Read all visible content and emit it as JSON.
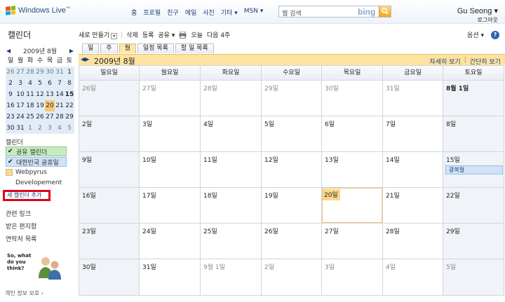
{
  "header": {
    "logo": "Windows Live",
    "logo_tm": "™",
    "nav": [
      "홈",
      "프로필",
      "친구",
      "메일",
      "사진",
      "기타 ▾",
      "MSN ▾"
    ],
    "search_value": "웹 검색",
    "search_brand": "bing",
    "user_name": "Gu Seong ▾",
    "user_sub": "로그아웃"
  },
  "sidebar": {
    "title": "캘린더",
    "mini_calendar": {
      "prev": "◀",
      "next": "▶",
      "month": "2009년 8월",
      "dow": [
        "일",
        "월",
        "화",
        "수",
        "목",
        "금",
        "토"
      ],
      "weeks": [
        [
          "26",
          "27",
          "28",
          "29",
          "30",
          "31",
          "1"
        ],
        [
          "2",
          "3",
          "4",
          "5",
          "6",
          "7",
          "8"
        ],
        [
          "9",
          "10",
          "11",
          "12",
          "13",
          "14",
          "15"
        ],
        [
          "16",
          "17",
          "18",
          "19",
          "20",
          "21",
          "22"
        ],
        [
          "23",
          "24",
          "25",
          "26",
          "27",
          "28",
          "29"
        ],
        [
          "30",
          "31",
          "1",
          "2",
          "3",
          "4",
          "5"
        ]
      ]
    },
    "calendars_label": "캘린더",
    "calendars": [
      {
        "label": "공유 캘린더",
        "color": "#c7ebc1"
      },
      {
        "label": "대한민국 공휴일",
        "color": "#cfe2f7"
      }
    ],
    "other_calendar": {
      "line1": "Webpyrus",
      "line2": "Developement",
      "color": "#f7d9a0"
    },
    "add_calendar": "새 캘린더 추가",
    "related_label": "관련 링크",
    "links": [
      "받은 편지함",
      "연락처 목록"
    ],
    "feedback": "So, what do you think?",
    "privacy": "개인 정보 보호 ›"
  },
  "toolbar": {
    "new": "새로 만들기",
    "delete": "삭제",
    "subscribe": "등록",
    "share": "공유 ▾",
    "today": "오늘",
    "next4": "다음 4주",
    "options": "옵션 ▾",
    "help": "?"
  },
  "tabs": [
    "일",
    "주",
    "월",
    "일정 목록",
    "할 일 목록"
  ],
  "active_tab": "월",
  "calendar": {
    "prev": "◀",
    "next": "▶",
    "month": "2009년 8월",
    "detail_link": "자세히 보기",
    "brief_link": "간단히 보기",
    "dow": [
      "일요일",
      "월요일",
      "화요일",
      "수요일",
      "목요일",
      "금요일",
      "토요일"
    ],
    "weeks": [
      [
        "26일",
        "27일",
        "28일",
        "29일",
        "30일",
        "31일",
        "8월 1일"
      ],
      [
        "2일",
        "3일",
        "4일",
        "5일",
        "6일",
        "7일",
        "8일"
      ],
      [
        "9일",
        "10일",
        "11일",
        "12일",
        "13일",
        "14일",
        "15일"
      ],
      [
        "16일",
        "17일",
        "18일",
        "19일",
        "20일",
        "21일",
        "22일"
      ],
      [
        "23일",
        "24일",
        "25일",
        "26일",
        "27일",
        "28일",
        "29일"
      ],
      [
        "30일",
        "31일",
        "9월 1일",
        "2일",
        "3일",
        "4일",
        "5일"
      ]
    ],
    "event": {
      "label": "광복절",
      "color": "#cfe2f7"
    }
  }
}
